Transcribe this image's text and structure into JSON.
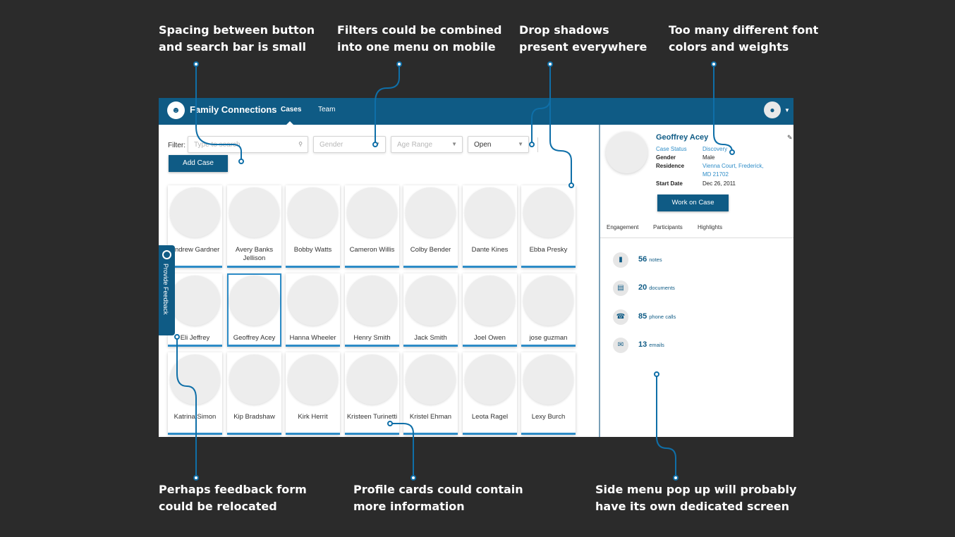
{
  "annotations": {
    "spacing": [
      "Spacing between button",
      "and search bar is small"
    ],
    "filters": [
      "Filters could be combined",
      "into one menu on mobile"
    ],
    "shadows": [
      "Drop shadows",
      "present everywhere"
    ],
    "fonts": [
      "Too many different font",
      "colors and weights"
    ],
    "feedback": [
      "Perhaps feedback form",
      "could be relocated"
    ],
    "cards": [
      "Profile cards could contain",
      "more information"
    ],
    "side": [
      "Side menu pop up will probably",
      "have its own dedicated screen"
    ]
  },
  "header": {
    "brand": "Family Connections",
    "nav": [
      "Cases",
      "Team"
    ]
  },
  "filters": {
    "label": "Filter:",
    "search_placeholder": "Type to search",
    "gender": "Gender",
    "age_range": "Age Range",
    "status": "Open",
    "add_case": "Add Case"
  },
  "cases": [
    [
      "Andrew Gardner",
      "Avery Banks Jellison",
      "Bobby Watts",
      "Cameron Willis",
      "Colby Bender",
      "Dante Kines",
      "Ebba Presky"
    ],
    [
      "Eli Jeffrey",
      "Geoffrey Acey",
      "Hanna Wheeler",
      "Henry Smith",
      "Jack Smith",
      "Joel Owen",
      "jose guzman"
    ],
    [
      "Katrina Simon",
      "Kip Bradshaw",
      "Kirk Herrit",
      "Kristeen Turinetti",
      "Kristel Ehman",
      "Leota Ragel",
      "Lexy Burch"
    ]
  ],
  "feedback_tab": "Provide Feedback",
  "panel": {
    "name": "Geoffrey Acey",
    "case_status_label": "Case Status",
    "case_status": "Discovery",
    "gender_label": "Gender",
    "gender": "Male",
    "residence_label": "Residence",
    "residence": "Vienna Court, Frederick, MD 21702",
    "start_label": "Start Date",
    "start": "Dec 26, 2011",
    "work_button": "Work on Case",
    "tabs": [
      "Engagement",
      "Participants",
      "Highlights"
    ],
    "stats": [
      {
        "count": "56",
        "label": "notes",
        "icon": "note-icon"
      },
      {
        "count": "20",
        "label": "documents",
        "icon": "document-icon"
      },
      {
        "count": "85",
        "label": "phone calls",
        "icon": "phone-icon"
      },
      {
        "count": "13",
        "label": "emails",
        "icon": "email-icon"
      }
    ]
  },
  "colors": {
    "brand": "#0f5b85",
    "accent": "#2d8cc7",
    "background": "#2b2b2b",
    "callout": "#0f6fa8"
  }
}
